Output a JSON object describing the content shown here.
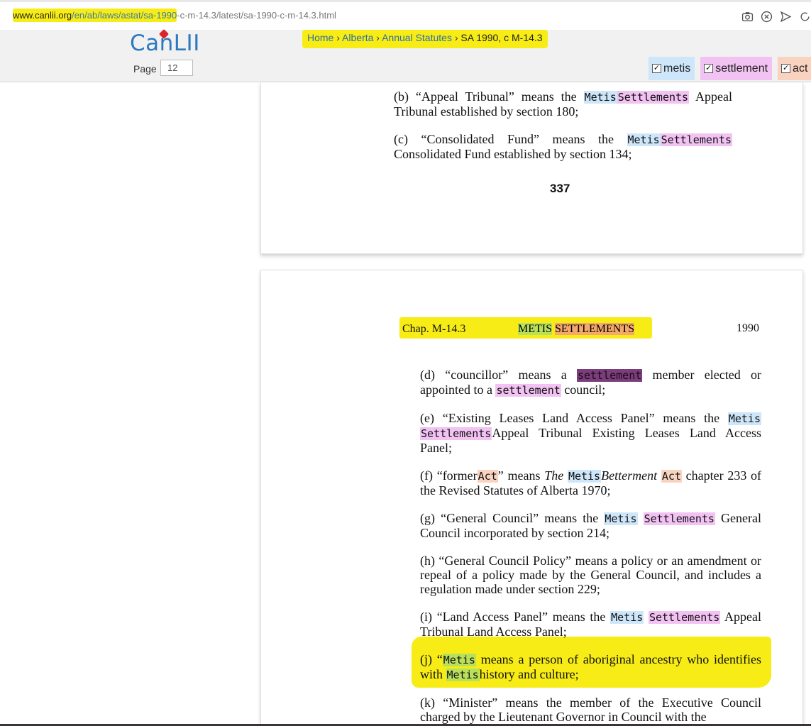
{
  "browser": {
    "url_highlighted_domain": "www.canlii.org",
    "url_highlighted_path": "/en/ab/laws/astat/sa-1990",
    "url_rest": "-c-m-14.3/latest/sa-1990-c-m-14.3.html",
    "icons": [
      "camera-icon",
      "close-circle-icon",
      "send-icon",
      "refresh-icon"
    ]
  },
  "header": {
    "logo": "CanLII",
    "page_label": "Page",
    "page_value": "12",
    "breadcrumb": [
      "Home",
      "Alberta",
      "Annual Statutes",
      "SA 1990, c M-14.3"
    ],
    "breadcrumb_sep": "›",
    "search_terms": [
      {
        "label": "metis",
        "color": "#cde6fa",
        "checked": true
      },
      {
        "label": "settlement",
        "color": "#f2c2f2",
        "checked": true
      },
      {
        "label": "act",
        "color": "#f9d3c0",
        "checked": true
      }
    ]
  },
  "document": {
    "page_337": {
      "b": {
        "pre": "(b) “Appeal Tribunal” means the",
        "metis": "Metis",
        "settlements": "Settlements",
        "post": "Appeal Tribunal established by section 180;"
      },
      "c": {
        "pre": "(c) “Consolidated Fund” means the",
        "metis": "Metis",
        "settlements": "Settlements",
        "post": "Consolidated Fund established by section 134;"
      },
      "page_number": "337"
    },
    "page_338": {
      "chap": "Chap. M-14.3",
      "title_metis": "METIS",
      "title_settlements": "SETTLEMENTS",
      "year": "1990",
      "d": {
        "pre": "(d) “councillor” means a",
        "w1": "settlement",
        "mid": "member elected or appointed to a",
        "w2": "settlement",
        "post": "council;"
      },
      "e": {
        "pre": "(e) “Existing Leases Land Access Panel” means the",
        "w1": "Metis",
        "w2": "Settlements",
        "post": "Appeal Tribunal Existing Leases Land Access Panel;"
      },
      "f": {
        "pre": "(f) “former",
        "w1": "Act",
        "mid1": "” means",
        "the": "The",
        "w2": "Metis",
        "bet": "Betterment",
        "w3": "Act",
        "post": "chapter 233 of the Revised Statutes of Alberta 1970;"
      },
      "g": {
        "pre": "(g) “General Council” means the",
        "w1": "Metis",
        "w2": "Settlements",
        "post": "General Council incorporated by section 214;"
      },
      "h": {
        "text": "(h) “General Council Policy” means a policy or an amendment or repeal of a policy made by the General Council, and includes a regulation made under section 229;"
      },
      "i": {
        "pre": "(i) “Land Access Panel” means the",
        "w1": "Metis",
        "w2": "Settlements",
        "post": "Appeal Tribunal Land Access Panel;"
      },
      "j": {
        "pre": "(j) “",
        "w1": "Metis",
        "mid": "means a person of aboriginal ancestry who identifies with",
        "w2": "Metis",
        "post": "history and culture;"
      },
      "k": {
        "text": "(k) “Minister” means the member of the Executive Council charged by the Lieutenant Governor in Council with the"
      }
    }
  }
}
